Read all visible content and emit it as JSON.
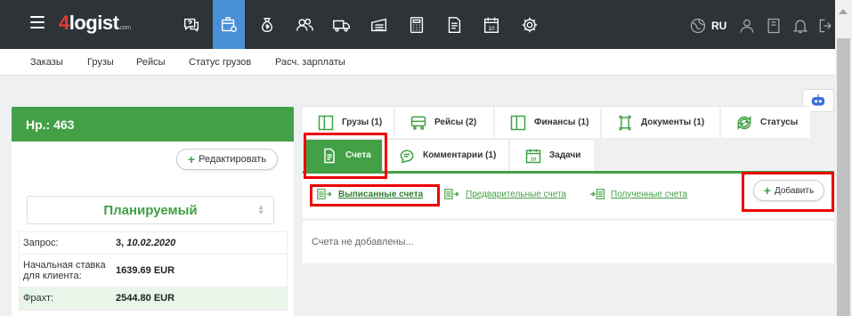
{
  "header": {
    "logo_prefix": "4",
    "logo_text": "logist",
    "logo_suffix": ".com",
    "lang": "RU",
    "nav_icons": [
      "help-chat-icon",
      "orders-globe-icon",
      "money-bag-icon",
      "users-icon",
      "truck-icon",
      "warehouse-icon",
      "calculator-icon",
      "document-icon",
      "calendar-icon",
      "settings-gear-icon"
    ],
    "right_icons": [
      "globe-icon",
      "user-icon",
      "book-icon",
      "bell-icon",
      "logout-icon"
    ]
  },
  "subnav": {
    "items": [
      "Заказы",
      "Грузы",
      "Рейсы",
      "Статус грузов",
      "Расч. зарплаты"
    ]
  },
  "order": {
    "title": "Нр.: 463",
    "edit_label": "Редактировать",
    "status": "Планируемый",
    "rows": [
      {
        "key": "Запрос:",
        "value": "3, ",
        "value_em": "10.02.2020"
      },
      {
        "key": "Начальная ставка для клиента:",
        "value": "1639.69 EUR"
      },
      {
        "key": "Фрахт:",
        "value": "2544.80 EUR"
      }
    ]
  },
  "tabs": {
    "row1": [
      "Грузы (1)",
      "Рейсы (2)",
      "Финансы (1)",
      "Документы (1)",
      "Статусы"
    ],
    "row2": [
      "Счета",
      "Комментарии (1)",
      "Задачи"
    ],
    "active": "Счета"
  },
  "invoices": {
    "links": [
      "Выписанные счета",
      "Предварительные счета",
      "Полученные счета"
    ],
    "active_link": "Выписанные счета",
    "add_label": "Добавить",
    "empty_text": "Счета не добавлены..."
  },
  "colors": {
    "accent_green": "#43a047",
    "topbar": "#2e3338",
    "active_nav": "#4a90d9",
    "highlight_red": "#e00000"
  }
}
